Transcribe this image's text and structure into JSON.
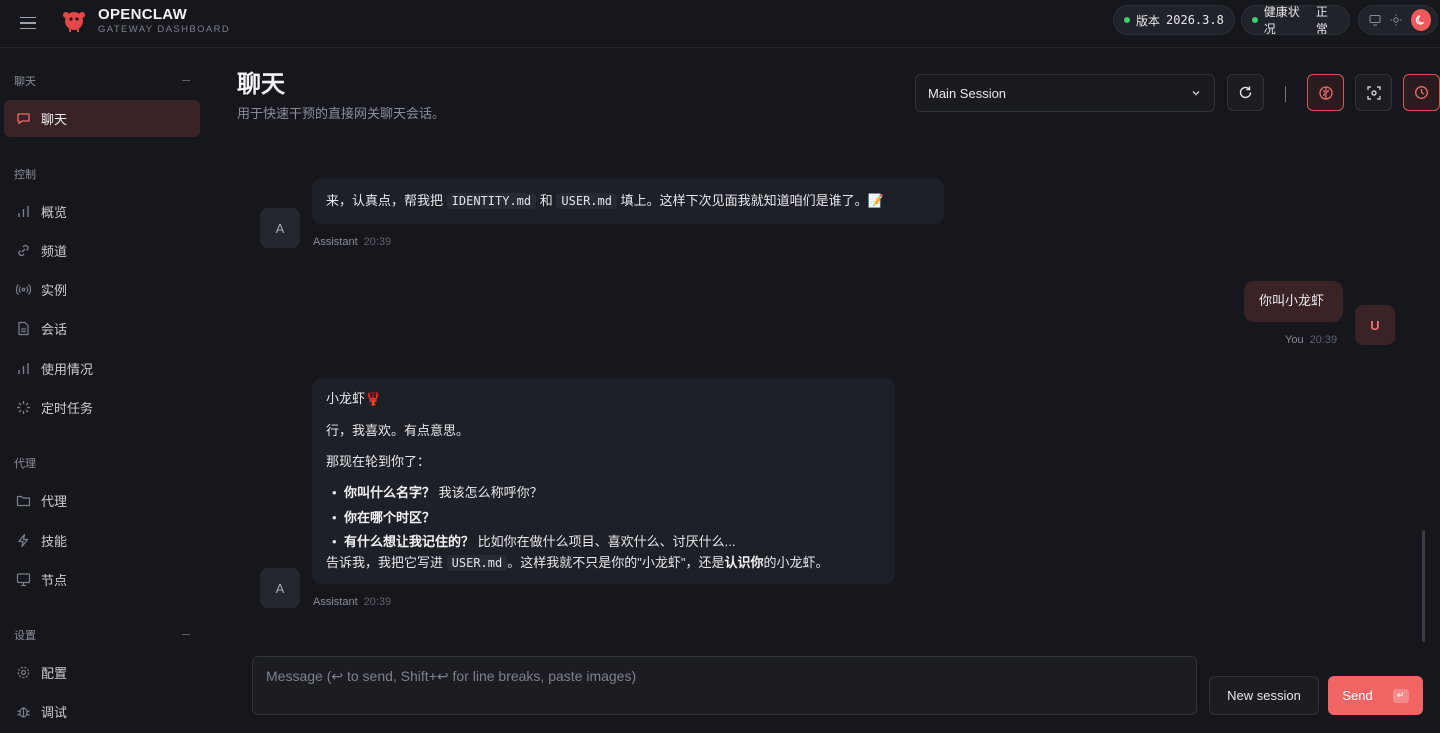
{
  "app": {
    "brand_title": "OPENCLAW",
    "brand_subtitle": "GATEWAY DASHBOARD",
    "version_label": "版本",
    "version_value": "2026.3.8",
    "health_label": "健康状况",
    "health_value": "正常"
  },
  "sidebar": {
    "sections": [
      {
        "label": "聊天",
        "items": [
          {
            "label": "聊天",
            "icon": "chat-icon",
            "active": true
          }
        ]
      },
      {
        "label": "控制",
        "items": [
          {
            "label": "概览",
            "icon": "bar-chart-icon"
          },
          {
            "label": "频道",
            "icon": "link-icon"
          },
          {
            "label": "实例",
            "icon": "broadcast-icon"
          },
          {
            "label": "会话",
            "icon": "document-icon"
          },
          {
            "label": "使用情况",
            "icon": "bar-chart-icon"
          },
          {
            "label": "定时任务",
            "icon": "loader-icon"
          }
        ]
      },
      {
        "label": "代理",
        "items": [
          {
            "label": "代理",
            "icon": "folder-icon"
          },
          {
            "label": "技能",
            "icon": "lightning-icon"
          },
          {
            "label": "节点",
            "icon": "monitor-icon"
          }
        ]
      },
      {
        "label": "设置",
        "items": [
          {
            "label": "配置",
            "icon": "gear-icon"
          },
          {
            "label": "调试",
            "icon": "bug-icon"
          }
        ]
      }
    ]
  },
  "header": {
    "title": "聊天",
    "subtitle": "用于快速干预的直接网关聊天会话。",
    "session_selected": "Main Session"
  },
  "messages": {
    "m1": {
      "avatar": "A",
      "sender": "Assistant",
      "time": "20:39",
      "line_prefix": "来，认真点，帮我把",
      "code1": "IDENTITY.md",
      "and": "和",
      "code2": "USER.md",
      "line_suffix": "填上。这样下次见面我就知道咱们是谁了。📝"
    },
    "m2": {
      "avatar": "U",
      "sender": "You",
      "time": "20:39",
      "text": "你叫小龙虾"
    },
    "m3": {
      "avatar": "A",
      "sender": "Assistant",
      "time": "20:39",
      "line1": "小龙虾🦞",
      "line2": "行，我喜欢。有点意思。",
      "line3": "那现在轮到你了：",
      "bullet1_bold": "你叫什么名字？",
      "bullet1_rest": "我该怎么称呼你？",
      "bullet2_bold": "你在哪个时区？",
      "bullet3_bold": "有什么想让我记住的？",
      "bullet3_rest": "比如你在做什么项目、喜欢什么、讨厌什么...",
      "last_prefix": "告诉我，我把它写进",
      "last_code": "USER.md",
      "last_mid": "。这样我就不只是你的\"小龙虾\"，还是",
      "last_bold": "认识你",
      "last_suffix": "的小龙虾。"
    }
  },
  "composer": {
    "placeholder": "Message (↩ to send, Shift+↩ for line breaks, paste images)",
    "new_session": "New session",
    "send": "Send"
  },
  "colors": {
    "accent": "#f06464",
    "status_ok": "#3ecf6e",
    "background": "#15171c"
  }
}
